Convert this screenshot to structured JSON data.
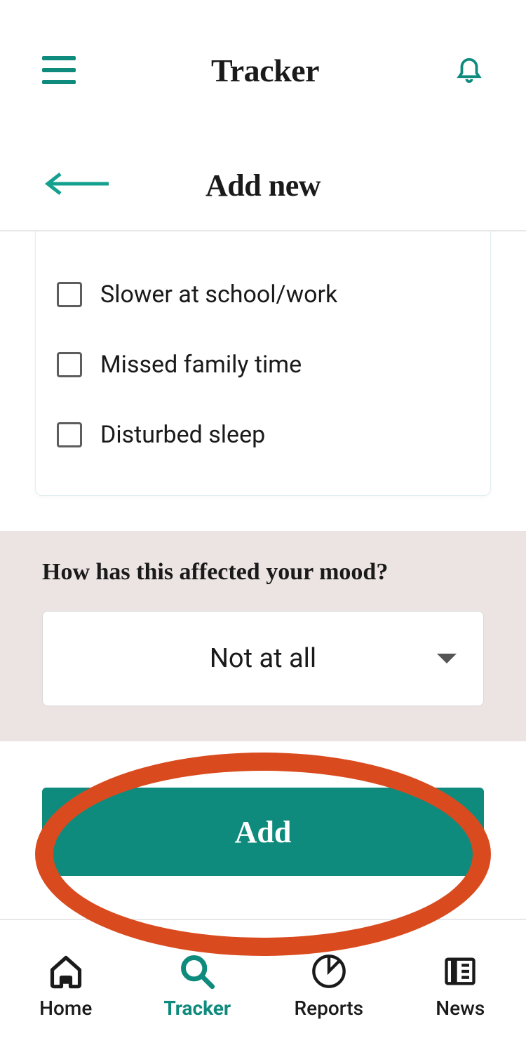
{
  "header": {
    "title": "Tracker"
  },
  "subheader": {
    "title": "Add new"
  },
  "checkboxes": {
    "items": [
      {
        "label": "Slower at school/work"
      },
      {
        "label": "Missed family time"
      },
      {
        "label": "Disturbed sleep"
      }
    ]
  },
  "mood": {
    "question": "How has this affected your mood?",
    "selected": "Not at all"
  },
  "actions": {
    "add_label": "Add"
  },
  "nav": {
    "items": [
      {
        "label": "Home"
      },
      {
        "label": "Tracker"
      },
      {
        "label": "Reports"
      },
      {
        "label": "News"
      }
    ],
    "active_index": 1
  },
  "colors": {
    "accent": "#0f8b7d",
    "highlight": "#d94b1f",
    "mood_bg": "#ece4e2"
  }
}
